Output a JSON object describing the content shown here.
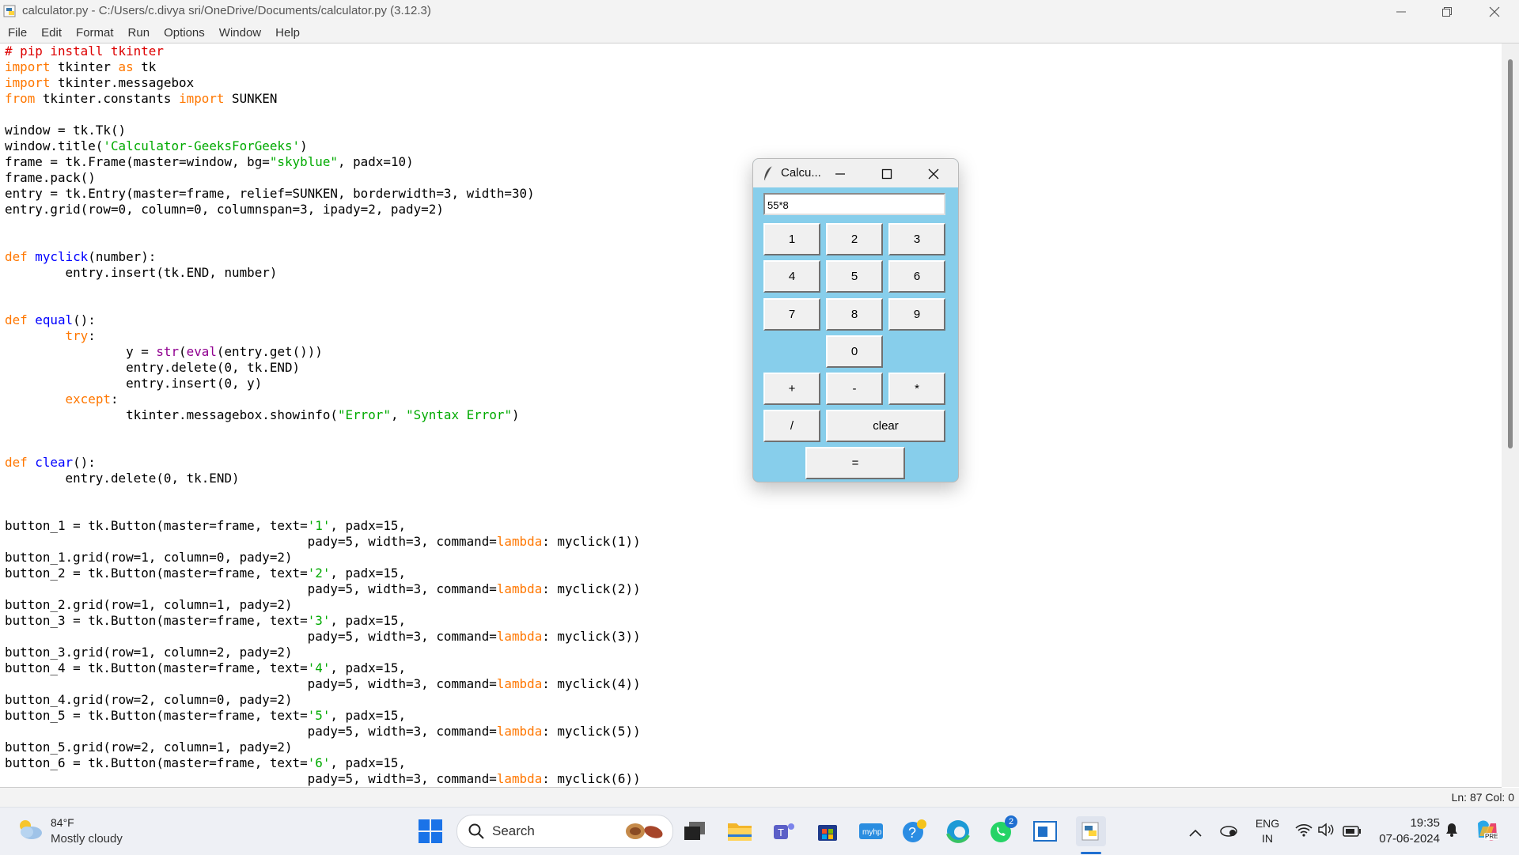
{
  "window": {
    "title": "calculator.py - C:/Users/c.divya sri/OneDrive/Documents/calculator.py (3.12.3)"
  },
  "menu": [
    "File",
    "Edit",
    "Format",
    "Run",
    "Options",
    "Window",
    "Help"
  ],
  "code_lines": [
    [
      [
        "# pip install tkinter",
        "cm"
      ]
    ],
    [
      [
        "import",
        "kw"
      ],
      [
        " tkinter ",
        ""
      ],
      [
        "as",
        "kw"
      ],
      [
        " tk",
        ""
      ]
    ],
    [
      [
        "import",
        "kw"
      ],
      [
        " tkinter.messagebox",
        ""
      ]
    ],
    [
      [
        "from",
        "kw"
      ],
      [
        " tkinter.constants ",
        ""
      ],
      [
        "import",
        "kw"
      ],
      [
        " SUNKEN",
        ""
      ]
    ],
    [],
    [
      [
        "window = tk.Tk()",
        ""
      ]
    ],
    [
      [
        "window.title(",
        ""
      ],
      [
        "'Calculator-GeeksForGeeks'",
        "st"
      ],
      [
        ")",
        ""
      ]
    ],
    [
      [
        "frame = tk.Frame(master=window, bg=",
        ""
      ],
      [
        "\"skyblue\"",
        "st"
      ],
      [
        ", padx=10)",
        ""
      ]
    ],
    [
      [
        "frame.pack()",
        ""
      ]
    ],
    [
      [
        "entry = tk.Entry(master=frame, relief=SUNKEN, borderwidth=3, width=30)",
        ""
      ]
    ],
    [
      [
        "entry.grid(row=0, column=0, columnspan=3, ipady=2, pady=2)",
        ""
      ]
    ],
    [],
    [],
    [
      [
        "def",
        "kw"
      ],
      [
        " ",
        ""
      ],
      [
        "myclick",
        "df"
      ],
      [
        "(number):",
        ""
      ]
    ],
    [
      [
        "        entry.insert(tk.END, number)",
        ""
      ]
    ],
    [],
    [],
    [
      [
        "def",
        "kw"
      ],
      [
        " ",
        ""
      ],
      [
        "equal",
        "df"
      ],
      [
        "():",
        ""
      ]
    ],
    [
      [
        "        ",
        ""
      ],
      [
        "try",
        "kw"
      ],
      [
        ":",
        ""
      ]
    ],
    [
      [
        "                y = ",
        ""
      ],
      [
        "str",
        "bi"
      ],
      [
        "(",
        ""
      ],
      [
        "eval",
        "bi"
      ],
      [
        "(entry.get()))",
        ""
      ]
    ],
    [
      [
        "                entry.delete(0, tk.END)",
        ""
      ]
    ],
    [
      [
        "                entry.insert(0, y)",
        ""
      ]
    ],
    [
      [
        "        ",
        ""
      ],
      [
        "except",
        "kw"
      ],
      [
        ":",
        ""
      ]
    ],
    [
      [
        "                tkinter.messagebox.showinfo(",
        ""
      ],
      [
        "\"Error\"",
        "st"
      ],
      [
        ", ",
        ""
      ],
      [
        "\"Syntax Error\"",
        "st"
      ],
      [
        ")",
        ""
      ]
    ],
    [],
    [],
    [
      [
        "def",
        "kw"
      ],
      [
        " ",
        ""
      ],
      [
        "clear",
        "df"
      ],
      [
        "():",
        ""
      ]
    ],
    [
      [
        "        entry.delete(0, tk.END)",
        ""
      ]
    ],
    [],
    [],
    [
      [
        "button_1 = tk.Button(master=frame, text=",
        ""
      ],
      [
        "'1'",
        "st"
      ],
      [
        ", padx=15,",
        ""
      ]
    ],
    [
      [
        "                                        pady=5, width=3, command=",
        ""
      ],
      [
        "lambda",
        "kw"
      ],
      [
        ": myclick(1))",
        ""
      ]
    ],
    [
      [
        "button_1.grid(row=1, column=0, pady=2)",
        ""
      ]
    ],
    [
      [
        "button_2 = tk.Button(master=frame, text=",
        ""
      ],
      [
        "'2'",
        "st"
      ],
      [
        ", padx=15,",
        ""
      ]
    ],
    [
      [
        "                                        pady=5, width=3, command=",
        ""
      ],
      [
        "lambda",
        "kw"
      ],
      [
        ": myclick(2))",
        ""
      ]
    ],
    [
      [
        "button_2.grid(row=1, column=1, pady=2)",
        ""
      ]
    ],
    [
      [
        "button_3 = tk.Button(master=frame, text=",
        ""
      ],
      [
        "'3'",
        "st"
      ],
      [
        ", padx=15,",
        ""
      ]
    ],
    [
      [
        "                                        pady=5, width=3, command=",
        ""
      ],
      [
        "lambda",
        "kw"
      ],
      [
        ": myclick(3))",
        ""
      ]
    ],
    [
      [
        "button_3.grid(row=1, column=2, pady=2)",
        ""
      ]
    ],
    [
      [
        "button_4 = tk.Button(master=frame, text=",
        ""
      ],
      [
        "'4'",
        "st"
      ],
      [
        ", padx=15,",
        ""
      ]
    ],
    [
      [
        "                                        pady=5, width=3, command=",
        ""
      ],
      [
        "lambda",
        "kw"
      ],
      [
        ": myclick(4))",
        ""
      ]
    ],
    [
      [
        "button_4.grid(row=2, column=0, pady=2)",
        ""
      ]
    ],
    [
      [
        "button_5 = tk.Button(master=frame, text=",
        ""
      ],
      [
        "'5'",
        "st"
      ],
      [
        ", padx=15,",
        ""
      ]
    ],
    [
      [
        "                                        pady=5, width=3, command=",
        ""
      ],
      [
        "lambda",
        "kw"
      ],
      [
        ": myclick(5))",
        ""
      ]
    ],
    [
      [
        "button_5.grid(row=2, column=1, pady=2)",
        ""
      ]
    ],
    [
      [
        "button_6 = tk.Button(master=frame, text=",
        ""
      ],
      [
        "'6'",
        "st"
      ],
      [
        ", padx=15,",
        ""
      ]
    ],
    [
      [
        "                                        pady=5, width=3, command=",
        ""
      ],
      [
        "lambda",
        "kw"
      ],
      [
        ": myclick(6))",
        ""
      ]
    ]
  ],
  "status": {
    "position": "Ln: 87   Col: 0"
  },
  "calculator": {
    "title": "Calcu...",
    "entry_value": "55*8",
    "buttons": {
      "b1": "1",
      "b2": "2",
      "b3": "3",
      "b4": "4",
      "b5": "5",
      "b6": "6",
      "b7": "7",
      "b8": "8",
      "b9": "9",
      "b0": "0",
      "plus": "+",
      "minus": "-",
      "mult": "*",
      "div": "/",
      "clear": "clear",
      "equal": "="
    }
  },
  "taskbar": {
    "weather_temp": "84°F",
    "weather_condition": "Mostly cloudy",
    "search_label": "Search",
    "whatsapp_badge": "2",
    "lang_line1": "ENG",
    "lang_line2": "IN",
    "time": "19:35",
    "date": "07-06-2024",
    "copilot_badge": "PRE"
  }
}
